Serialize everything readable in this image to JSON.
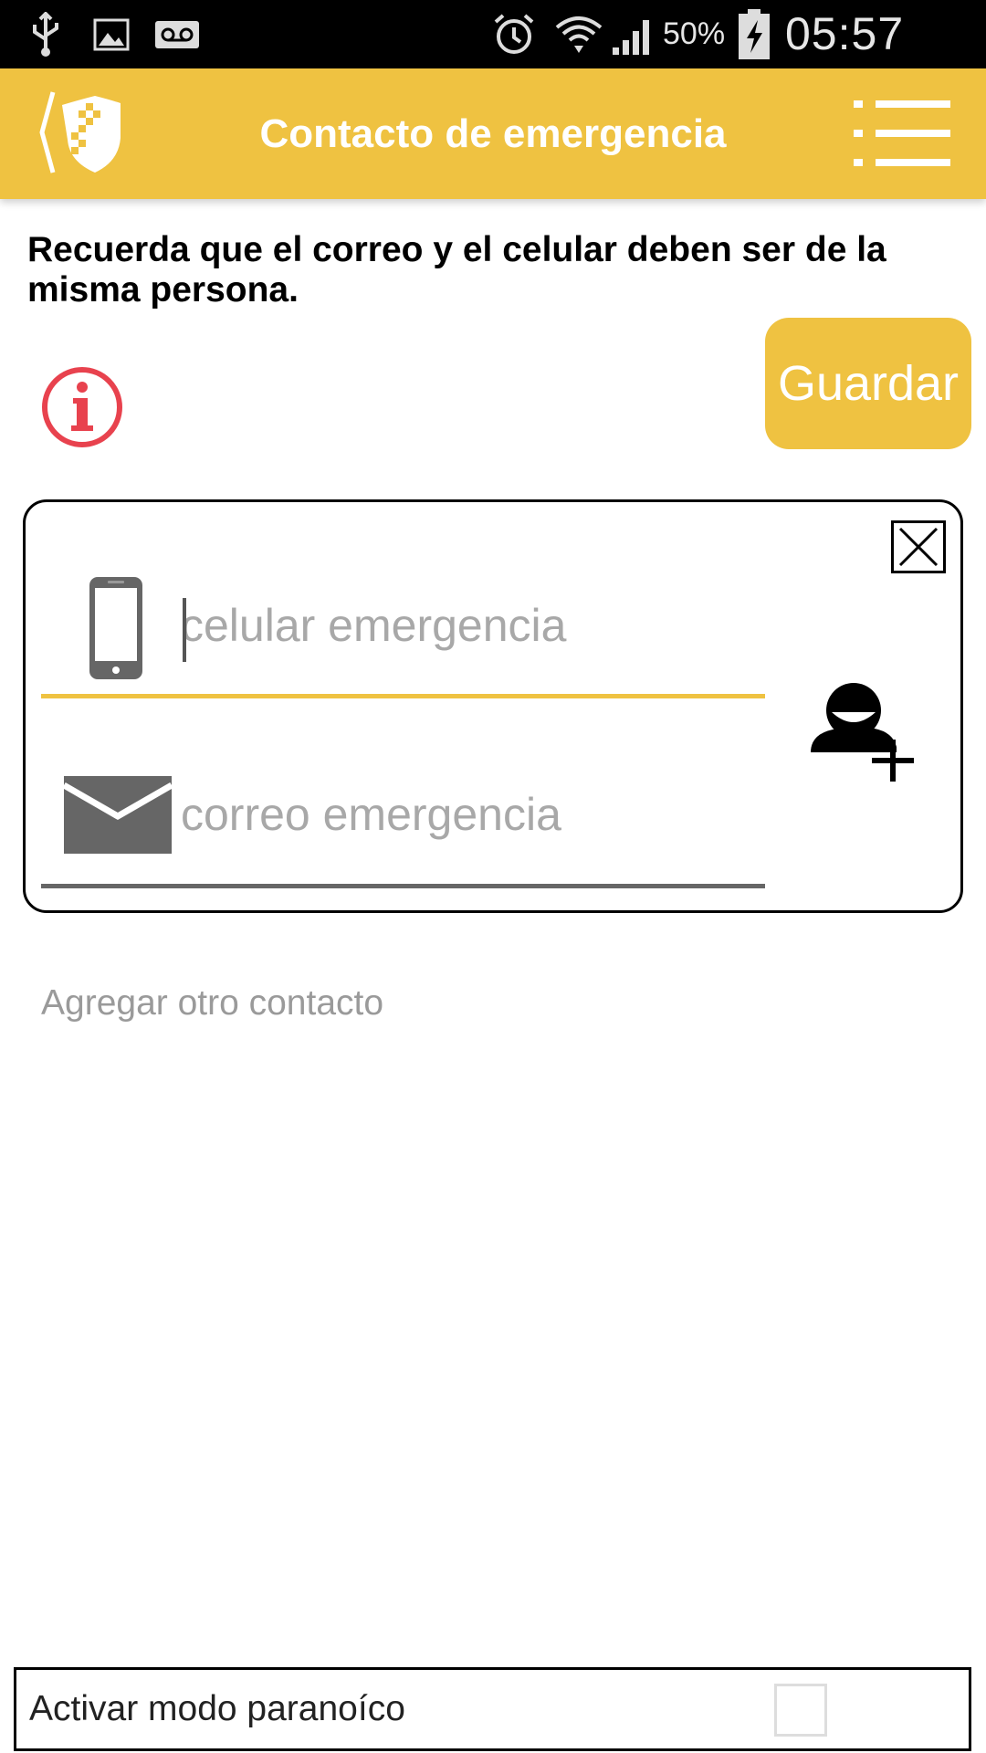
{
  "status_bar": {
    "battery_percent": "50%",
    "time": "05:57 PM",
    "icons": [
      "usb-icon",
      "image-icon",
      "voicemail-icon",
      "alarm-icon",
      "wifi-icon",
      "signal-icon",
      "battery-icon"
    ]
  },
  "header": {
    "title": "Contacto de emergencia",
    "back_icon": "back-shield-logo-icon",
    "menu_icon": "menu-list-icon",
    "background": "#efc241"
  },
  "notice": {
    "text": "Recuerda que el correo y el celular deben ser de la misma persona."
  },
  "info_icon": "info-icon",
  "save_button": {
    "label": "Guardar"
  },
  "contact_card": {
    "phone": {
      "value": "",
      "placeholder": "celular emergencia",
      "icon": "smartphone-icon"
    },
    "email": {
      "value": "",
      "placeholder": "correo emergencia",
      "icon": "envelope-icon"
    },
    "close_icon": "close-icon",
    "add_contact_icon": "add-contact-icon"
  },
  "add_another_contact": "Agregar otro contacto",
  "paranoid_mode": {
    "label": "Activar modo paranoíco",
    "checked": false
  },
  "colors": {
    "accent": "#efc241",
    "info_red": "#e8424e",
    "placeholder": "#a8a8a8"
  }
}
